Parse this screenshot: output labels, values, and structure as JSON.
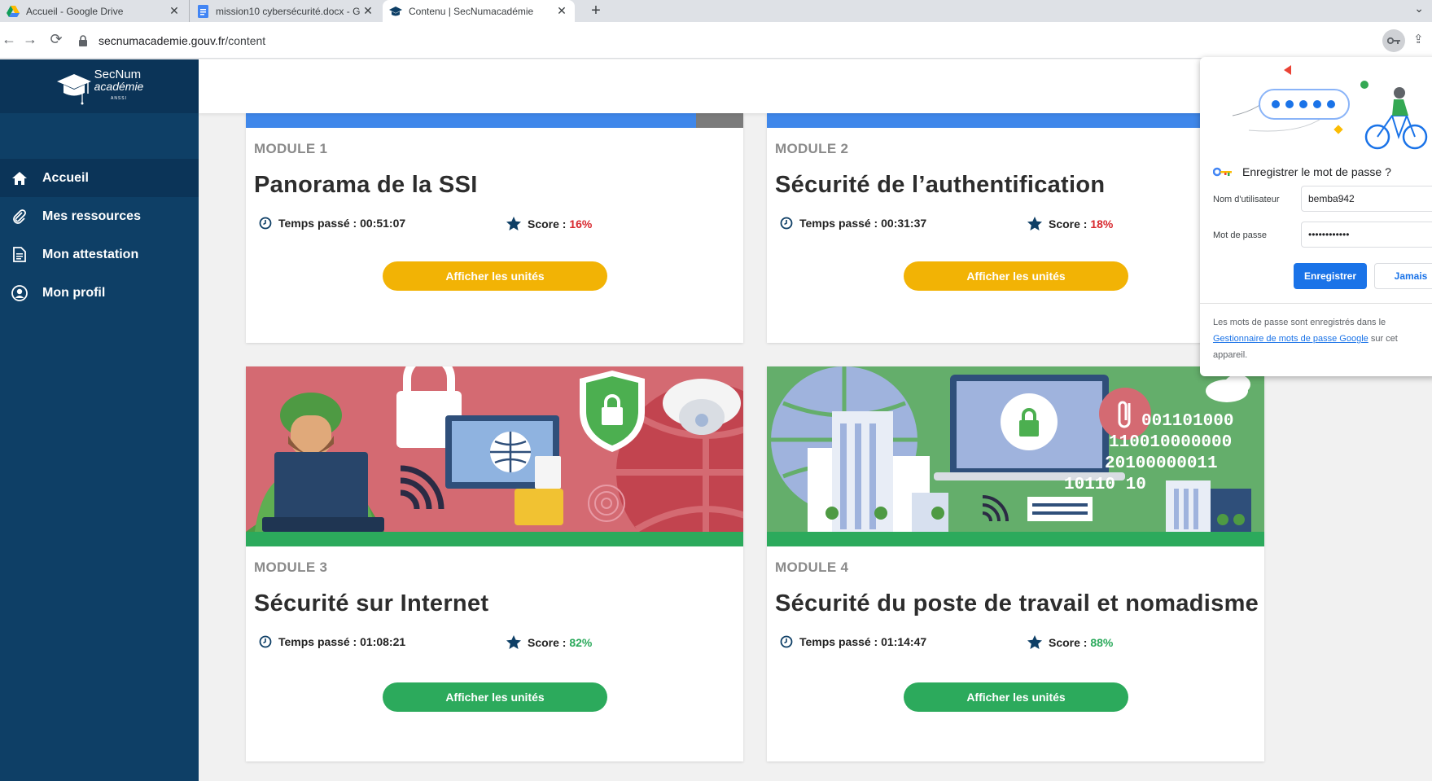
{
  "browser": {
    "tabs": [
      {
        "title": "Accueil - Google Drive",
        "icon": "google-drive-icon"
      },
      {
        "title": "mission10 cybersécurité.docx - G",
        "icon": "google-docs-icon"
      },
      {
        "title": "Contenu | SecNumacadémie",
        "icon": "secnum-cap-icon",
        "active": true
      }
    ],
    "url_domain": "secnumacademie.gouv.fr",
    "url_path": "/content"
  },
  "sidebar": {
    "logo": {
      "line1": "SecNum",
      "line2": "académie",
      "line3": "ANSSI"
    },
    "items": [
      {
        "label": "Accueil",
        "icon": "home-icon",
        "active": true
      },
      {
        "label": "Mes ressources",
        "icon": "paperclip-icon"
      },
      {
        "label": "Mon attestation",
        "icon": "document-icon"
      },
      {
        "label": "Mon profil",
        "icon": "user-icon"
      }
    ]
  },
  "modules": [
    {
      "label": "MODULE 1",
      "title": "Panorama de la SSI",
      "time_label": "Temps passé :",
      "time": "00:51:07",
      "score_label": "Score :",
      "score": "16%",
      "progress_fraction": 0.905,
      "button": "Afficher les unités"
    },
    {
      "label": "MODULE 2",
      "title": "Sécurité de l’authentification",
      "time_label": "Temps passé :",
      "time": "00:31:37",
      "score_label": "Score :",
      "score": "18%",
      "progress_fraction": 1.0,
      "button": "Afficher les unités"
    },
    {
      "label": "MODULE 3",
      "title": "Sécurité sur Internet",
      "time_label": "Temps passé :",
      "time": "01:08:21",
      "score_label": "Score :",
      "score": "82%",
      "progress_fraction": 1.0,
      "button": "Afficher les unités"
    },
    {
      "label": "MODULE 4",
      "title": "Sécurité du poste de travail et nomadisme",
      "time_label": "Temps passé :",
      "time": "01:14:47",
      "score_label": "Score :",
      "score": "88%",
      "progress_fraction": 1.0,
      "button": "Afficher les unités"
    }
  ],
  "banner4_binary": [
    "001101000",
    "110010000000",
    "20100000011",
    "10110 10"
  ],
  "password_popup": {
    "title": "Enregistrer le mot de passe ?",
    "username_label": "Nom d'utilisateur",
    "username_value": "bemba942",
    "password_label": "Mot de passe",
    "password_value": "••••••••••••",
    "save_button": "Enregistrer",
    "never_button": "Jamais",
    "footer_text": "Les mots de passe sont enregistrés dans le",
    "footer_link": "Gestionnaire de mots de passe Google",
    "footer_text2": "sur cet appareil."
  },
  "colors": {
    "sidebar": "#0e3f66",
    "progress_blue": "#3f87ea",
    "progress_green": "#2caa5c",
    "button_yellow": "#f2b305",
    "button_green": "#2caa5c",
    "score_low": "#d8292f",
    "score_high": "#2caa5c",
    "chrome_blue": "#1a73e8"
  }
}
